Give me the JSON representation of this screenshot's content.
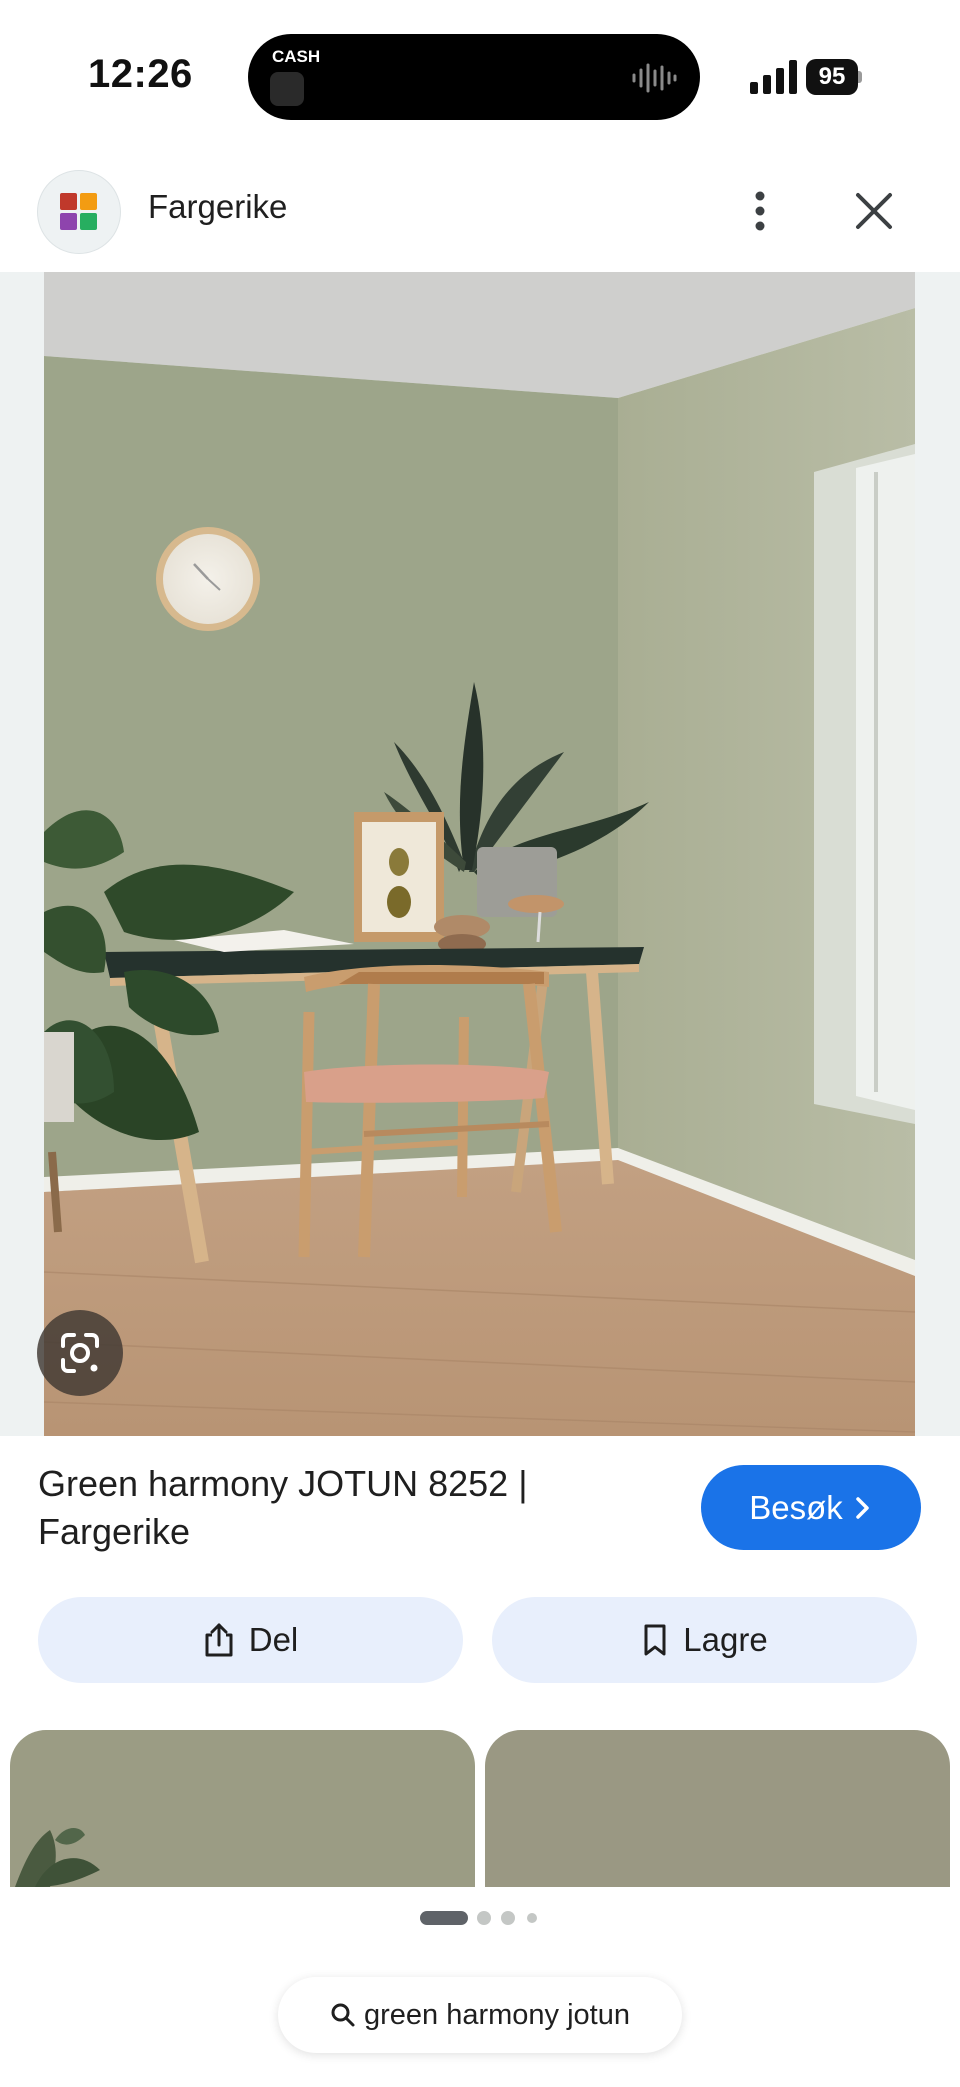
{
  "status_bar": {
    "time": "12:26",
    "island_label": "CASH",
    "battery": "95"
  },
  "header": {
    "site_name": "Fargerike",
    "logo_colors": [
      "#c0392b",
      "#f39c12",
      "#27ae60",
      "#8e44ad"
    ]
  },
  "result": {
    "title": "Green harmony JOTUN 8252 | Fargerike",
    "visit_label": "Besøk",
    "share_label": "Del",
    "save_label": "Lagre"
  },
  "search": {
    "query": "green harmony jotun"
  },
  "colors": {
    "accent": "#1a73e8",
    "pill_bg": "#e8effc",
    "wall": "#9da58a"
  }
}
